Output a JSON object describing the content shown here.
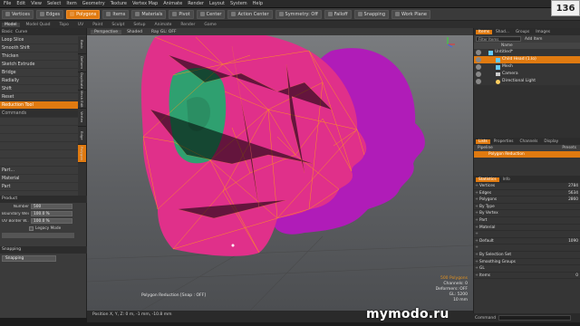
{
  "menubar": [
    "File",
    "Edit",
    "View",
    "Select",
    "Item",
    "Geometry",
    "Texture",
    "Vertex Map",
    "Animate",
    "Render",
    "Layout",
    "System",
    "Help"
  ],
  "toolbar": [
    {
      "label": "Vertices",
      "active": false
    },
    {
      "label": "Edges",
      "active": false
    },
    {
      "label": "Polygons",
      "active": true
    },
    {
      "label": "Items",
      "active": false
    },
    {
      "label": "Materials",
      "active": false
    },
    {
      "label": "Pivot",
      "active": false
    },
    {
      "label": "Center",
      "active": false
    },
    {
      "label": "Action Center",
      "active": false
    },
    {
      "label": "Symmetry: Off",
      "active": false
    },
    {
      "label": "Falloff",
      "active": false
    },
    {
      "label": "Snapping",
      "active": false
    },
    {
      "label": "Work Plane",
      "active": false
    }
  ],
  "subtabs": [
    "Model",
    "Model Quad",
    "Topo",
    "UV",
    "Paint",
    "Sculpt",
    "Setup",
    "Animate",
    "Render",
    "Game"
  ],
  "left_tabs": [
    "Basic",
    "Curve"
  ],
  "tools": [
    {
      "label": "Loop Slice",
      "type": "item"
    },
    {
      "label": "Smooth Shift",
      "type": "item"
    },
    {
      "label": "Thicken",
      "type": "item"
    },
    {
      "label": "Sketch Extrude",
      "type": "item"
    },
    {
      "label": "Bridge",
      "type": "item"
    },
    {
      "label": "Radially",
      "type": "item"
    },
    {
      "label": "Shift",
      "type": "item"
    },
    {
      "label": "Reset",
      "type": "item"
    },
    {
      "label": "Reduction Tool",
      "type": "selected"
    },
    {
      "label": "Commands",
      "type": "section"
    },
    {
      "label": "",
      "type": "item"
    },
    {
      "label": "",
      "type": "item"
    },
    {
      "label": "",
      "type": "item"
    },
    {
      "label": "",
      "type": "item"
    },
    {
      "label": "",
      "type": "item"
    },
    {
      "label": "",
      "type": "item"
    },
    {
      "label": "Part...",
      "type": "item"
    },
    {
      "label": "Material",
      "type": "item"
    },
    {
      "label": "Part",
      "type": "item"
    }
  ],
  "vtabs": [
    "Basic",
    "Deform",
    "Duplicate",
    "Mesh Edit",
    "Vertex",
    "Edge",
    "Polygon"
  ],
  "props": {
    "header": "Product",
    "rows": [
      {
        "label": "Number",
        "value": "500"
      },
      {
        "label": "Boundary Weight",
        "value": "100.0 %"
      },
      {
        "label": "UV Border W...",
        "value": "100.0 %"
      }
    ],
    "legacy_label": "Legacy Mode",
    "snapping_header": "Snapping",
    "snapping_value": "Snapping"
  },
  "viewport": {
    "tabs": [
      "Perspective",
      "Shaded",
      "Ray GL: OFF"
    ],
    "status_text": "Polygon Reduction  [Snap : OFF]",
    "info_lines": [
      {
        "text": "500 Polygons",
        "white": false
      },
      {
        "text": "Channels: 0",
        "white": true
      },
      {
        "text": "Deformers: OFF",
        "white": true
      },
      {
        "text": "GL: 5200",
        "white": true
      },
      {
        "text": "10 mm",
        "white": true
      }
    ]
  },
  "statusbar": "Position X, Y, Z:  0 m, -1 mm, -10.8 mm",
  "items_panel": {
    "tabs": [
      "Items",
      "Shad...",
      "Groups",
      "Images"
    ],
    "filter_placeholder": "Filter Items",
    "add_item": "Add Item",
    "col_header": "Name",
    "items": [
      {
        "label": "Untitled*",
        "type": "scene",
        "sel": false,
        "indent": 6
      },
      {
        "label": "Child Head (1.lo)",
        "type": "mesh",
        "sel": true,
        "indent": 14
      },
      {
        "label": "Mesh",
        "type": "mesh",
        "sel": false,
        "indent": 14
      },
      {
        "label": "Camera",
        "type": "camera",
        "sel": false,
        "indent": 14
      },
      {
        "label": "Directional Light",
        "type": "light",
        "sel": false,
        "indent": 14
      }
    ]
  },
  "lower_tabs": [
    "Lists",
    "Properties",
    "Channels",
    "Display"
  ],
  "pipeline": {
    "left": "Pipeline",
    "right": "Presets",
    "row": "Polygon Reduction"
  },
  "stats_tabs": [
    "Statistics",
    "Info"
  ],
  "stats": [
    {
      "name": "Vertices",
      "value": "2784"
    },
    {
      "name": "Edges",
      "value": "5634"
    },
    {
      "name": "Polygons",
      "value": "2860"
    },
    {
      "name": "By Type",
      "value": ""
    },
    {
      "name": "By Vertex",
      "value": ""
    },
    {
      "name": "Part",
      "value": ""
    },
    {
      "name": "Material",
      "value": ""
    },
    {
      "name": "",
      "value": ""
    },
    {
      "name": "Default",
      "value": "1090"
    },
    {
      "name": "",
      "value": ""
    },
    {
      "name": "By Selection Set",
      "value": ""
    },
    {
      "name": "Smoothing Groups",
      "value": ""
    },
    {
      "name": "GL",
      "value": ""
    },
    {
      "name": "Items",
      "value": "0"
    }
  ],
  "command_label": "Command",
  "watermark": "mymodo.ru",
  "logo": "136",
  "colors": {
    "accent": "#e07a10",
    "mesh_pink": "#e0308a",
    "mesh_magenta": "#b01cb8",
    "wire": "#ff9a1a",
    "cheek_green": "#2fa070"
  }
}
